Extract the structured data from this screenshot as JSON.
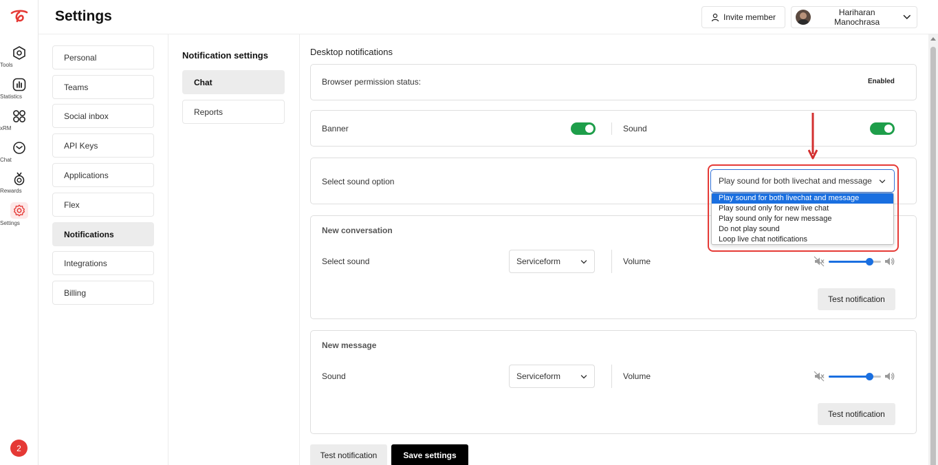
{
  "rail": {
    "items": [
      {
        "label": "Tools",
        "icon": "tools-icon"
      },
      {
        "label": "Statistics",
        "icon": "statistics-icon"
      },
      {
        "label": "xRM",
        "icon": "xrm-icon"
      },
      {
        "label": "Chat",
        "icon": "chat-icon"
      },
      {
        "label": "Rewards",
        "icon": "rewards-icon"
      },
      {
        "label": "Settings",
        "icon": "gear-icon"
      }
    ],
    "badge": "2"
  },
  "header": {
    "title": "Settings",
    "invite_label": "Invite member",
    "user_name": "Hariharan Manochrasa"
  },
  "settings_nav": {
    "items": [
      "Personal",
      "Teams",
      "Social inbox",
      "API Keys",
      "Applications",
      "Flex",
      "Notifications",
      "Integrations",
      "Billing"
    ],
    "active": "Notifications"
  },
  "notification_settings": {
    "title": "Notification settings",
    "items": [
      "Chat",
      "Reports"
    ],
    "active": "Chat"
  },
  "main": {
    "section_title": "Desktop notifications",
    "permission": {
      "label": "Browser permission status:",
      "value": "Enabled"
    },
    "banner_label": "Banner",
    "sound_label": "Sound",
    "sound_option": {
      "label": "Select sound option",
      "selected": "Play sound for both livechat and message",
      "options": [
        "Play sound for both livechat and message",
        "Play sound only for new live chat",
        "Play sound only for new message",
        "Do not play sound",
        "Loop live chat notifications"
      ]
    },
    "new_conversation": {
      "title": "New conversation",
      "select_label": "Select sound",
      "sound_value": "Serviceform",
      "volume_label": "Volume",
      "volume_level": 0.78,
      "test_label": "Test notification"
    },
    "new_message": {
      "title": "New message",
      "select_label": "Sound",
      "sound_value": "Serviceform",
      "volume_label": "Volume",
      "volume_level": 0.78,
      "test_label": "Test notification"
    },
    "footer": {
      "test_label": "Test notification",
      "save_label": "Save settings"
    }
  },
  "colors": {
    "accent": "#1a6fe0",
    "toggle_on": "#1e9e4a",
    "annotation": "#e53935"
  }
}
